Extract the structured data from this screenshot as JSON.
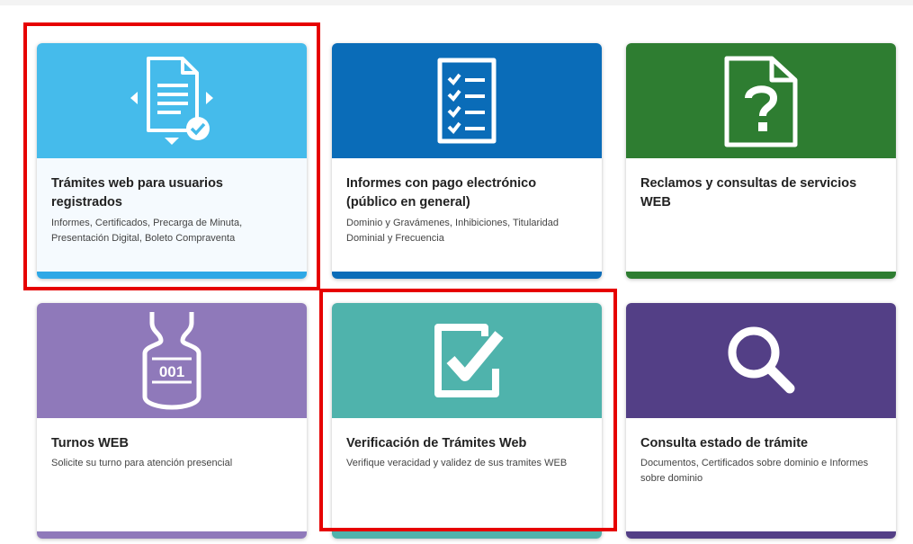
{
  "cards": [
    {
      "title": "Trámites web para usuarios registrados",
      "description": "Informes, Certificados, Precarga de Minuta, Presentación Digital, Boleto Compraventa",
      "icon": "document-transfer-check-icon",
      "header_color": "#45bbeb",
      "bar_color": "#2fa8e6",
      "body_color": "#f5fafe"
    },
    {
      "title": "Informes con pago electrónico (público en general)",
      "description": "Dominio y Gravámenes, Inhibiciones, Titularidad Dominial y Frecuencia",
      "icon": "checklist-document-icon",
      "header_color": "#0a6cb8",
      "bar_color": "#0a6cb8",
      "body_color": "#ffffff"
    },
    {
      "title": "Reclamos y consultas de servicios WEB",
      "description": "",
      "icon": "question-document-icon",
      "header_color": "#2e7d31",
      "bar_color": "#2e7d31",
      "body_color": "#ffffff"
    },
    {
      "title": "Turnos WEB",
      "description": "Solicite su turno para atención presencial",
      "icon": "queue-ticket-icon",
      "ticket_number": "001",
      "header_color": "#8f79ba",
      "bar_color": "#8f79ba",
      "body_color": "#ffffff"
    },
    {
      "title": "Verificación de Trámites Web",
      "description": "Verifique veracidad y validez de sus tramites WEB",
      "icon": "checkbox-checked-icon",
      "header_color": "#4fb3ac",
      "bar_color": "#4fb3ac",
      "body_color": "#ffffff"
    },
    {
      "title": "Consulta estado de trámite",
      "description": "Documentos, Certificados sobre dominio e Informes sobre dominio",
      "icon": "magnifier-icon",
      "header_color": "#533f86",
      "bar_color": "#533f86",
      "body_color": "#ffffff"
    }
  ],
  "highlight_color": "#e60000"
}
